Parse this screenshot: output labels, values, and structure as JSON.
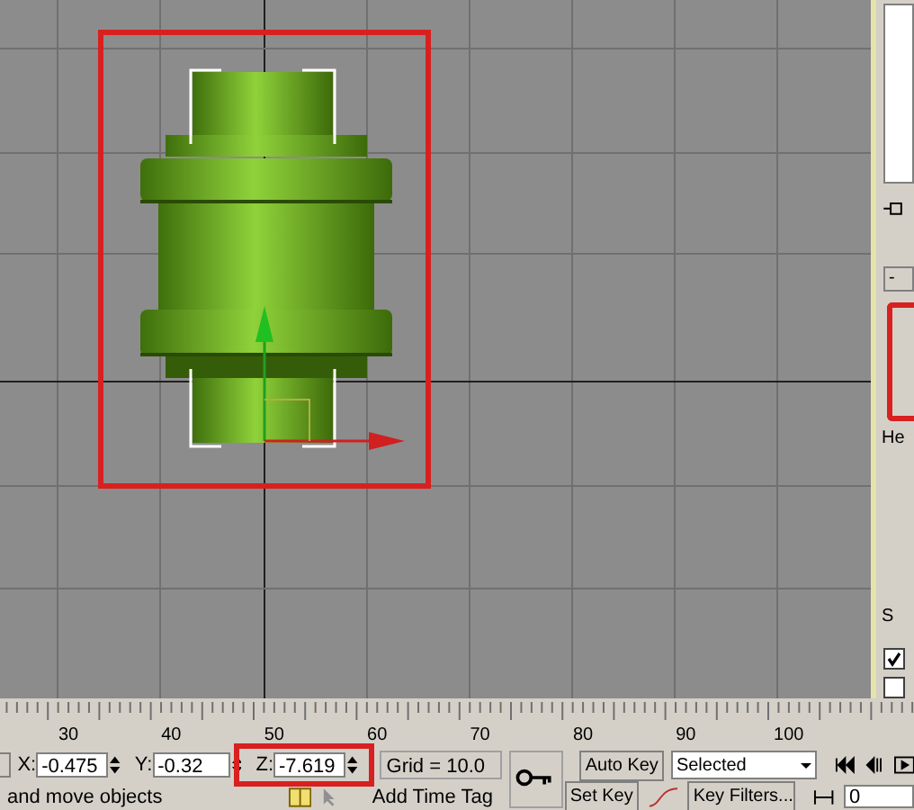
{
  "command_panel": {
    "rollout_toggle": "-",
    "labels": [
      "He",
      "S"
    ],
    "checkboxes": [
      {
        "checked": true
      },
      {
        "checked": false
      }
    ]
  },
  "timeline": {
    "ticks": [
      "30",
      "40",
      "50",
      "60",
      "70",
      "80",
      "90",
      "100"
    ]
  },
  "transform": {
    "fields": [
      {
        "label": "X:",
        "value": "-0.475"
      },
      {
        "label": "Y:",
        "value": "-0.32"
      },
      {
        "label": "Z:",
        "value": "-7.619"
      }
    ],
    "grid": "Grid = 10.0"
  },
  "animation": {
    "auto_key": "Auto Key",
    "key_mode": "Selected",
    "set_key": "Set Key",
    "key_filters": "Key Filters...",
    "frame": "0"
  },
  "status_bar": {
    "prompt": "and move objects",
    "time_tag": "Add Time Tag"
  }
}
